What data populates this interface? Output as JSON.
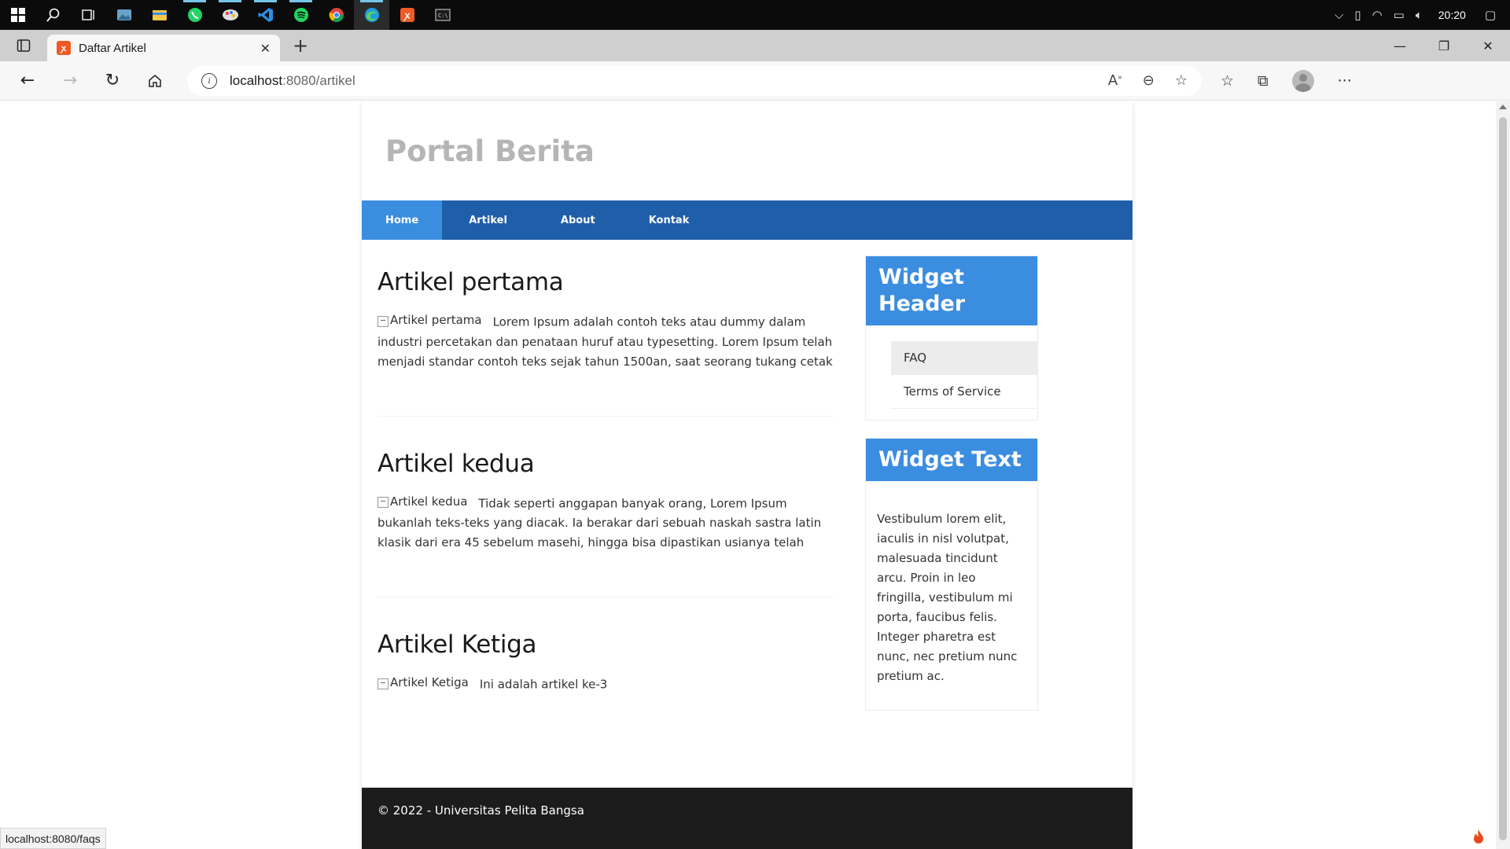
{
  "taskbar": {
    "clock": "20:20",
    "items": [
      "windows-start",
      "search",
      "task-view",
      "photos",
      "file-explorer",
      "whatsapp",
      "paint",
      "vscode",
      "spotify",
      "chrome",
      "edge",
      "xampp",
      "terminal"
    ]
  },
  "browser": {
    "tab_title": "Daftar Artikel",
    "url_host": "localhost",
    "url_rest": ":8080/artikel",
    "status_url": "localhost:8080/faqs"
  },
  "site": {
    "title": "Portal Berita",
    "menu": [
      "Home",
      "Artikel",
      "About",
      "Kontak"
    ],
    "articles": [
      {
        "title": "Artikel pertama",
        "img_alt": "Artikel pertama",
        "body": "Lorem Ipsum adalah contoh teks atau dummy dalam industri percetakan dan penataan huruf atau typesetting. Lorem Ipsum telah menjadi standar contoh teks sejak tahun 1500an, saat seorang tukang cetak"
      },
      {
        "title": "Artikel kedua",
        "img_alt": "Artikel kedua",
        "body": "Tidak seperti anggapan banyak orang, Lorem Ipsum bukanlah teks-teks yang diacak. Ia berakar dari sebuah naskah sastra latin klasik dari era 45 sebelum masehi, hingga bisa dipastikan usianya telah"
      },
      {
        "title": "Artikel Ketiga",
        "img_alt": "Artikel Ketiga",
        "body": "Ini adalah artikel ke-3"
      }
    ],
    "widget_header": {
      "title": "Widget Header",
      "links": [
        "FAQ",
        "Terms of Service"
      ]
    },
    "widget_text": {
      "title": "Widget Text",
      "body": "Vestibulum lorem elit, iaculis in nisl volutpat, malesuada tincidunt arcu. Proin in leo fringilla, vestibulum mi porta, faucibus felis. Integer pharetra est nunc, nec pretium nunc pretium ac."
    },
    "footer": "© 2022 - Universitas Pelita Bangsa"
  }
}
